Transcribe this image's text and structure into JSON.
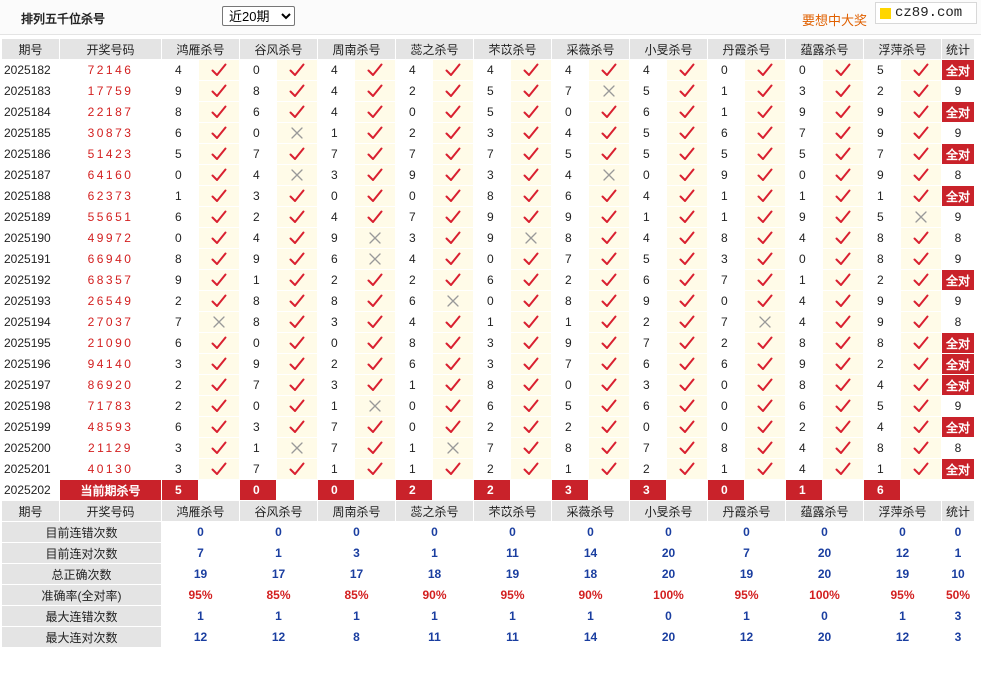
{
  "header": {
    "title": "排列五千位杀号",
    "period_options": [
      "近20期"
    ],
    "period_selected": "近20期",
    "slogan": "要想中大奖",
    "logo_text": "cz89.com"
  },
  "columns": {
    "period": "期号",
    "draw": "开奖号码",
    "experts": [
      "鸿雁杀号",
      "谷风杀号",
      "周南杀号",
      "蕊之杀号",
      "芣苡杀号",
      "采薇杀号",
      "小旻杀号",
      "丹霞杀号",
      "蕴露杀号",
      "浮萍杀号"
    ],
    "stat": "统计"
  },
  "rows": [
    {
      "period": "2025182",
      "draw": "72146",
      "kills": [
        [
          4,
          1
        ],
        [
          0,
          1
        ],
        [
          4,
          1
        ],
        [
          4,
          1
        ],
        [
          4,
          1
        ],
        [
          4,
          1
        ],
        [
          4,
          1
        ],
        [
          0,
          1
        ],
        [
          0,
          1
        ],
        [
          5,
          1
        ]
      ],
      "stat": "全对"
    },
    {
      "period": "2025183",
      "draw": "17759",
      "kills": [
        [
          9,
          1
        ],
        [
          8,
          1
        ],
        [
          4,
          1
        ],
        [
          2,
          1
        ],
        [
          5,
          1
        ],
        [
          7,
          0
        ],
        [
          5,
          1
        ],
        [
          1,
          1
        ],
        [
          3,
          1
        ],
        [
          2,
          1
        ]
      ],
      "stat": "9"
    },
    {
      "period": "2025184",
      "draw": "22187",
      "kills": [
        [
          8,
          1
        ],
        [
          6,
          1
        ],
        [
          4,
          1
        ],
        [
          0,
          1
        ],
        [
          5,
          1
        ],
        [
          0,
          1
        ],
        [
          6,
          1
        ],
        [
          1,
          1
        ],
        [
          9,
          1
        ],
        [
          9,
          1
        ]
      ],
      "stat": "全对"
    },
    {
      "period": "2025185",
      "draw": "30873",
      "kills": [
        [
          6,
          1
        ],
        [
          0,
          0
        ],
        [
          1,
          1
        ],
        [
          2,
          1
        ],
        [
          3,
          1
        ],
        [
          4,
          1
        ],
        [
          5,
          1
        ],
        [
          6,
          1
        ],
        [
          7,
          1
        ],
        [
          9,
          1
        ]
      ],
      "stat": "9"
    },
    {
      "period": "2025186",
      "draw": "51423",
      "kills": [
        [
          5,
          1
        ],
        [
          7,
          1
        ],
        [
          7,
          1
        ],
        [
          7,
          1
        ],
        [
          7,
          1
        ],
        [
          5,
          1
        ],
        [
          5,
          1
        ],
        [
          5,
          1
        ],
        [
          5,
          1
        ],
        [
          7,
          1
        ]
      ],
      "stat": "全对"
    },
    {
      "period": "2025187",
      "draw": "64160",
      "kills": [
        [
          0,
          1
        ],
        [
          4,
          0
        ],
        [
          3,
          1
        ],
        [
          9,
          1
        ],
        [
          3,
          1
        ],
        [
          4,
          0
        ],
        [
          0,
          1
        ],
        [
          9,
          1
        ],
        [
          0,
          1
        ],
        [
          9,
          1
        ]
      ],
      "stat": "8"
    },
    {
      "period": "2025188",
      "draw": "62373",
      "kills": [
        [
          1,
          1
        ],
        [
          3,
          1
        ],
        [
          0,
          1
        ],
        [
          0,
          1
        ],
        [
          8,
          1
        ],
        [
          6,
          1
        ],
        [
          4,
          1
        ],
        [
          1,
          1
        ],
        [
          1,
          1
        ],
        [
          1,
          1
        ]
      ],
      "stat": "全对"
    },
    {
      "period": "2025189",
      "draw": "55651",
      "kills": [
        [
          6,
          1
        ],
        [
          2,
          1
        ],
        [
          4,
          1
        ],
        [
          7,
          1
        ],
        [
          9,
          1
        ],
        [
          9,
          1
        ],
        [
          1,
          1
        ],
        [
          1,
          1
        ],
        [
          9,
          1
        ],
        [
          5,
          0
        ]
      ],
      "stat": "9"
    },
    {
      "period": "2025190",
      "draw": "49972",
      "kills": [
        [
          0,
          1
        ],
        [
          4,
          1
        ],
        [
          9,
          0
        ],
        [
          3,
          1
        ],
        [
          9,
          0
        ],
        [
          8,
          1
        ],
        [
          4,
          1
        ],
        [
          8,
          1
        ],
        [
          4,
          1
        ],
        [
          8,
          1
        ]
      ],
      "stat": "8"
    },
    {
      "period": "2025191",
      "draw": "66940",
      "kills": [
        [
          8,
          1
        ],
        [
          9,
          1
        ],
        [
          6,
          0
        ],
        [
          4,
          1
        ],
        [
          0,
          1
        ],
        [
          7,
          1
        ],
        [
          5,
          1
        ],
        [
          3,
          1
        ],
        [
          0,
          1
        ],
        [
          8,
          1
        ]
      ],
      "stat": "9"
    },
    {
      "period": "2025192",
      "draw": "68357",
      "kills": [
        [
          9,
          1
        ],
        [
          1,
          1
        ],
        [
          2,
          1
        ],
        [
          2,
          1
        ],
        [
          6,
          1
        ],
        [
          2,
          1
        ],
        [
          6,
          1
        ],
        [
          7,
          1
        ],
        [
          1,
          1
        ],
        [
          2,
          1
        ]
      ],
      "stat": "全对"
    },
    {
      "period": "2025193",
      "draw": "26549",
      "kills": [
        [
          2,
          1
        ],
        [
          8,
          1
        ],
        [
          8,
          1
        ],
        [
          6,
          0
        ],
        [
          0,
          1
        ],
        [
          8,
          1
        ],
        [
          9,
          1
        ],
        [
          0,
          1
        ],
        [
          4,
          1
        ],
        [
          9,
          1
        ]
      ],
      "stat": "9"
    },
    {
      "period": "2025194",
      "draw": "27037",
      "kills": [
        [
          7,
          0
        ],
        [
          8,
          1
        ],
        [
          3,
          1
        ],
        [
          4,
          1
        ],
        [
          1,
          1
        ],
        [
          1,
          1
        ],
        [
          2,
          1
        ],
        [
          7,
          0
        ],
        [
          4,
          1
        ],
        [
          9,
          1
        ]
      ],
      "stat": "8"
    },
    {
      "period": "2025195",
      "draw": "21090",
      "kills": [
        [
          6,
          1
        ],
        [
          0,
          1
        ],
        [
          0,
          1
        ],
        [
          8,
          1
        ],
        [
          3,
          1
        ],
        [
          9,
          1
        ],
        [
          7,
          1
        ],
        [
          2,
          1
        ],
        [
          8,
          1
        ],
        [
          8,
          1
        ]
      ],
      "stat": "全对"
    },
    {
      "period": "2025196",
      "draw": "94140",
      "kills": [
        [
          3,
          1
        ],
        [
          9,
          1
        ],
        [
          2,
          1
        ],
        [
          6,
          1
        ],
        [
          3,
          1
        ],
        [
          7,
          1
        ],
        [
          6,
          1
        ],
        [
          6,
          1
        ],
        [
          9,
          1
        ],
        [
          2,
          1
        ]
      ],
      "stat": "全对"
    },
    {
      "period": "2025197",
      "draw": "86920",
      "kills": [
        [
          2,
          1
        ],
        [
          7,
          1
        ],
        [
          3,
          1
        ],
        [
          1,
          1
        ],
        [
          8,
          1
        ],
        [
          0,
          1
        ],
        [
          3,
          1
        ],
        [
          0,
          1
        ],
        [
          8,
          1
        ],
        [
          4,
          1
        ]
      ],
      "stat": "全对"
    },
    {
      "period": "2025198",
      "draw": "71783",
      "kills": [
        [
          2,
          1
        ],
        [
          0,
          1
        ],
        [
          1,
          0
        ],
        [
          0,
          1
        ],
        [
          6,
          1
        ],
        [
          5,
          1
        ],
        [
          6,
          1
        ],
        [
          0,
          1
        ],
        [
          6,
          1
        ],
        [
          5,
          1
        ]
      ],
      "stat": "9"
    },
    {
      "period": "2025199",
      "draw": "48593",
      "kills": [
        [
          6,
          1
        ],
        [
          3,
          1
        ],
        [
          7,
          1
        ],
        [
          0,
          1
        ],
        [
          2,
          1
        ],
        [
          2,
          1
        ],
        [
          0,
          1
        ],
        [
          0,
          1
        ],
        [
          2,
          1
        ],
        [
          4,
          1
        ]
      ],
      "stat": "全对"
    },
    {
      "period": "2025200",
      "draw": "21129",
      "kills": [
        [
          3,
          1
        ],
        [
          1,
          0
        ],
        [
          7,
          1
        ],
        [
          1,
          0
        ],
        [
          7,
          1
        ],
        [
          8,
          1
        ],
        [
          7,
          1
        ],
        [
          8,
          1
        ],
        [
          4,
          1
        ],
        [
          8,
          1
        ]
      ],
      "stat": "8"
    },
    {
      "period": "2025201",
      "draw": "40130",
      "kills": [
        [
          3,
          1
        ],
        [
          7,
          1
        ],
        [
          1,
          1
        ],
        [
          1,
          1
        ],
        [
          2,
          1
        ],
        [
          1,
          1
        ],
        [
          2,
          1
        ],
        [
          1,
          1
        ],
        [
          4,
          1
        ],
        [
          1,
          1
        ]
      ],
      "stat": "全对"
    }
  ],
  "current": {
    "period": "2025202",
    "label": "当前期杀号",
    "kills": [
      "5",
      "0",
      "0",
      "2",
      "2",
      "3",
      "3",
      "0",
      "1",
      "6"
    ]
  },
  "summary": [
    {
      "label": "目前连错次数",
      "values": [
        "0",
        "0",
        "0",
        "0",
        "0",
        "0",
        "0",
        "0",
        "0",
        "0"
      ],
      "stat": "0",
      "style": "blue"
    },
    {
      "label": "目前连对次数",
      "values": [
        "7",
        "1",
        "3",
        "1",
        "11",
        "14",
        "20",
        "7",
        "20",
        "12"
      ],
      "stat": "1",
      "style": "blue"
    },
    {
      "label": "总正确次数",
      "values": [
        "19",
        "17",
        "17",
        "18",
        "19",
        "18",
        "20",
        "19",
        "20",
        "19"
      ],
      "stat": "10",
      "style": "blue"
    },
    {
      "label": "准确率(全对率)",
      "values": [
        "95%",
        "85%",
        "85%",
        "90%",
        "95%",
        "90%",
        "100%",
        "95%",
        "100%",
        "95%"
      ],
      "stat": "50%",
      "style": "red"
    },
    {
      "label": "最大连错次数",
      "values": [
        "1",
        "1",
        "1",
        "1",
        "1",
        "1",
        "0",
        "1",
        "0",
        "1"
      ],
      "stat": "3",
      "style": "blue"
    },
    {
      "label": "最大连对次数",
      "values": [
        "12",
        "12",
        "8",
        "11",
        "11",
        "14",
        "20",
        "12",
        "20",
        "12"
      ],
      "stat": "3",
      "style": "blue"
    }
  ],
  "icons": {
    "correct": "check-icon",
    "wrong": "cross-icon"
  },
  "colors": {
    "accent": "#c9222a",
    "draw_digits": "#d32020",
    "summary_blue": "#1a3ea0",
    "highlight_bg": "#fffbe8",
    "header_bg": "#e4e4e4"
  }
}
